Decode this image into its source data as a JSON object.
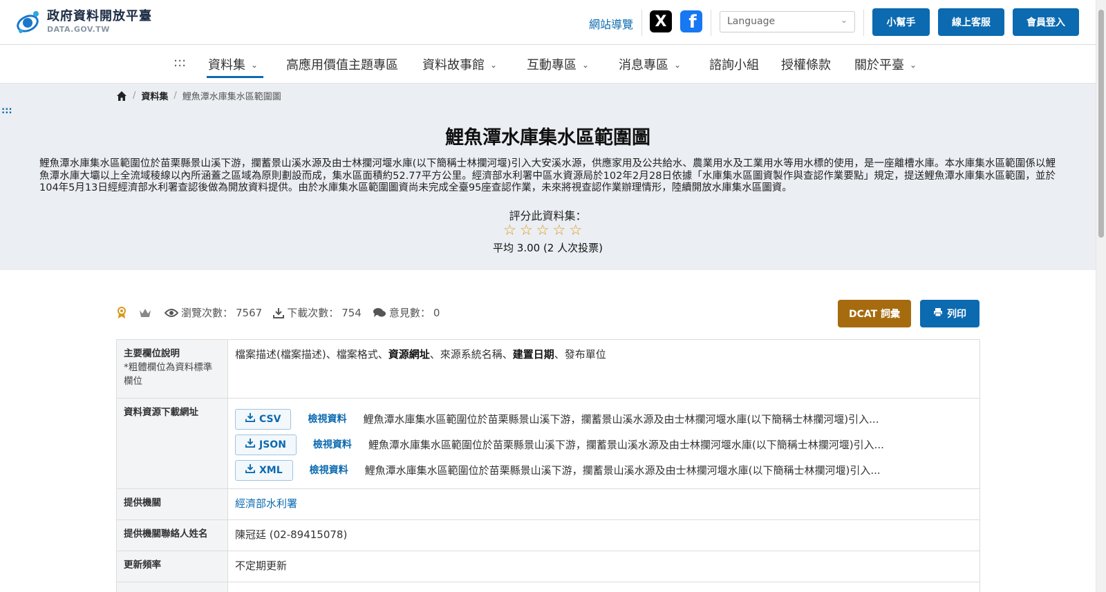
{
  "header": {
    "logo_title": "政府資料開放平臺",
    "logo_sub": "DATA.GOV.TW",
    "site_nav": "網站導覽",
    "language_placeholder": "Language",
    "buttons": {
      "helper": "小幫手",
      "support": "線上客服",
      "login": "會員登入"
    }
  },
  "nav": {
    "dots": ":::",
    "items": [
      {
        "label": "資料集"
      },
      {
        "label": "高應用價值主題專區"
      },
      {
        "label": "資料故事館"
      },
      {
        "label": "互動專區"
      },
      {
        "label": "消息專區"
      },
      {
        "label": "諮詢小組"
      },
      {
        "label": "授權條款"
      },
      {
        "label": "關於平臺"
      }
    ]
  },
  "breadcrumb": {
    "level1": "資料集",
    "current": "鯉魚潭水庫集水區範圍圖"
  },
  "hero": {
    "dots": ":::",
    "title": "鯉魚潭水庫集水區範圍圖",
    "description": "鯉魚潭水庫集水區範圍位於苗栗縣景山溪下游，攔蓄景山溪水源及由士林攔河堰水庫(以下簡稱士林攔河堰)引入大安溪水源，供應家用及公共給水、農業用水及工業用水等用水標的使用，是一座離槽水庫。本水庫集水區範圍係以鯉魚潭水庫大壩以上全流域稜線以內所涵蓋之區域為原則劃設而成，集水區面積約52.77平方公里。經濟部水利署中區水資源局於102年2月28日依據「水庫集水區圖資製作與查認作業要點」規定，提送鯉魚潭水庫集水區範圍，並於104年5月13日經經濟部水利署查認後做為開放資料提供。由於水庫集水區範圍圖資尚未完成全臺95座查認作業，未來將視查認作業辦理情形，陸續開放水庫集水區圖資。",
    "rate_label": "評分此資料集：",
    "rating_stars_filled": 0,
    "rating_stars_total": 5,
    "rate_avg": "平均 3.00 (2 人次投票)"
  },
  "stats": {
    "views_label": "瀏覽次數：",
    "views": "7567",
    "downloads_label": "下載次數：",
    "downloads": "754",
    "comments_label": "意見數：",
    "comments": "0"
  },
  "actions": {
    "dcat": "DCAT 詞彙",
    "print": "列印"
  },
  "table": {
    "fields": {
      "label": "主要欄位說明",
      "note": "*粗體欄位為資料標準欄位",
      "parts": [
        {
          "text": "檔案描述(檔案描述)",
          "bold": false
        },
        {
          "text": "、檔案格式、",
          "bold": false
        },
        {
          "text": "資源網址",
          "bold": true
        },
        {
          "text": "、來源系統名稱、",
          "bold": false
        },
        {
          "text": "建置日期",
          "bold": true
        },
        {
          "text": "、發布單位",
          "bold": false
        }
      ]
    },
    "resources": {
      "label": "資料資源下載網址",
      "view_label": "檢視資料",
      "items": [
        {
          "format": "CSV",
          "desc": "鯉魚潭水庫集水區範圍位於苗栗縣景山溪下游，攔蓄景山溪水源及由士林攔河堰水庫(以下簡稱士林攔河堰)引入..."
        },
        {
          "format": "JSON",
          "desc": "鯉魚潭水庫集水區範圍位於苗栗縣景山溪下游，攔蓄景山溪水源及由士林攔河堰水庫(以下簡稱士林攔河堰)引入..."
        },
        {
          "format": "XML",
          "desc": "鯉魚潭水庫集水區範圍位於苗栗縣景山溪下游，攔蓄景山溪水源及由士林攔河堰水庫(以下簡稱士林攔河堰)引入..."
        }
      ]
    },
    "provider": {
      "label": "提供機關",
      "value": "經濟部水利署"
    },
    "contact": {
      "label": "提供機關聯絡人姓名",
      "value": "陳冠廷 (02-89415078)"
    },
    "frequency": {
      "label": "更新頻率",
      "value": "不定期更新"
    }
  },
  "colors": {
    "primary": "#0b6ab0",
    "dcat": "#a56b0e",
    "star": "#d79a1a",
    "hero_bg": "#ebeef2"
  }
}
